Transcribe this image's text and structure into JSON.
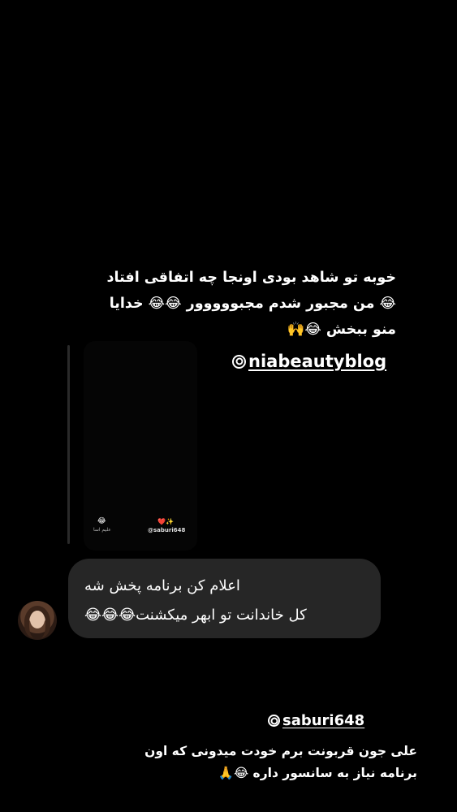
{
  "caption_top": {
    "line1": "خوبه تو شاهد بودی اونجا چه اتفاقی افتاد",
    "line2": "😂 من مجبور شدم مجبووووور 😂😂 خدایا",
    "line3": "منو ببخش 😂🙌"
  },
  "mention_top": {
    "handle": "niabeautyblog",
    "icon": "threads-icon"
  },
  "story_thumb": {
    "handle": "@saburi648",
    "sparkle": "❤️✨",
    "emoji": "😂",
    "small_text": "علیم اسا"
  },
  "message": {
    "line1": "اعلام کن برنامه پخش شه",
    "line2": "کل خاندانت تو ابهر میکشنت😂😂😂"
  },
  "mention_bottom": {
    "handle": "saburi648",
    "icon": "threads-icon"
  },
  "caption_bottom": {
    "line1": "علی جون قربونت برم خودت میدونی که اون",
    "line2": "برنامه نیاز به سانسور داره 😂🙏"
  }
}
